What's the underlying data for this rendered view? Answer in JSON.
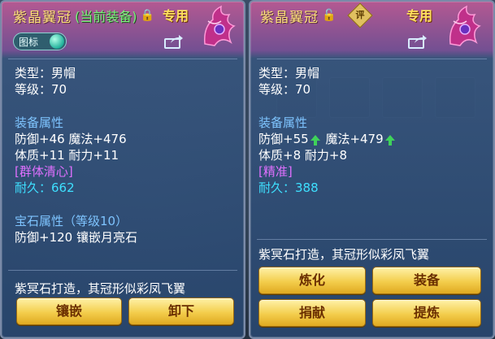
{
  "left_panel": {
    "title": "紫晶翼冠",
    "title_note": "(当前装备)",
    "exclusive": "专用",
    "toggle_label": "图标",
    "type_line": "类型：男帽",
    "level_line": "等级：70",
    "equip_attr_header": "装备属性",
    "attr_line1": "防御+46 魔法+476",
    "attr_line2": "体质+11 耐力+11",
    "special": "[群体清心]",
    "durability": "耐久：662",
    "gem_header": "宝石属性（等级10）",
    "gem_line": "防御+120 镶嵌月亮石",
    "description": "紫冥石打造，其冠形似彩凤飞翼",
    "buttons": [
      "镶嵌",
      "卸下"
    ]
  },
  "right_panel": {
    "title": "紫晶翼冠",
    "badge": "评",
    "exclusive": "专用",
    "type_line": "类型：男帽",
    "level_line": "等级：70",
    "equip_attr_header": "装备属性",
    "defense": "防御+55",
    "magic": "魔法+479",
    "attr_line2": "体质+8 耐力+8",
    "special": "[精准]",
    "durability": "耐久：388",
    "description": "紫冥石打造，其冠形似彩凤飞翼",
    "buttons": [
      "炼化",
      "装备",
      "捐献",
      "提炼"
    ]
  }
}
